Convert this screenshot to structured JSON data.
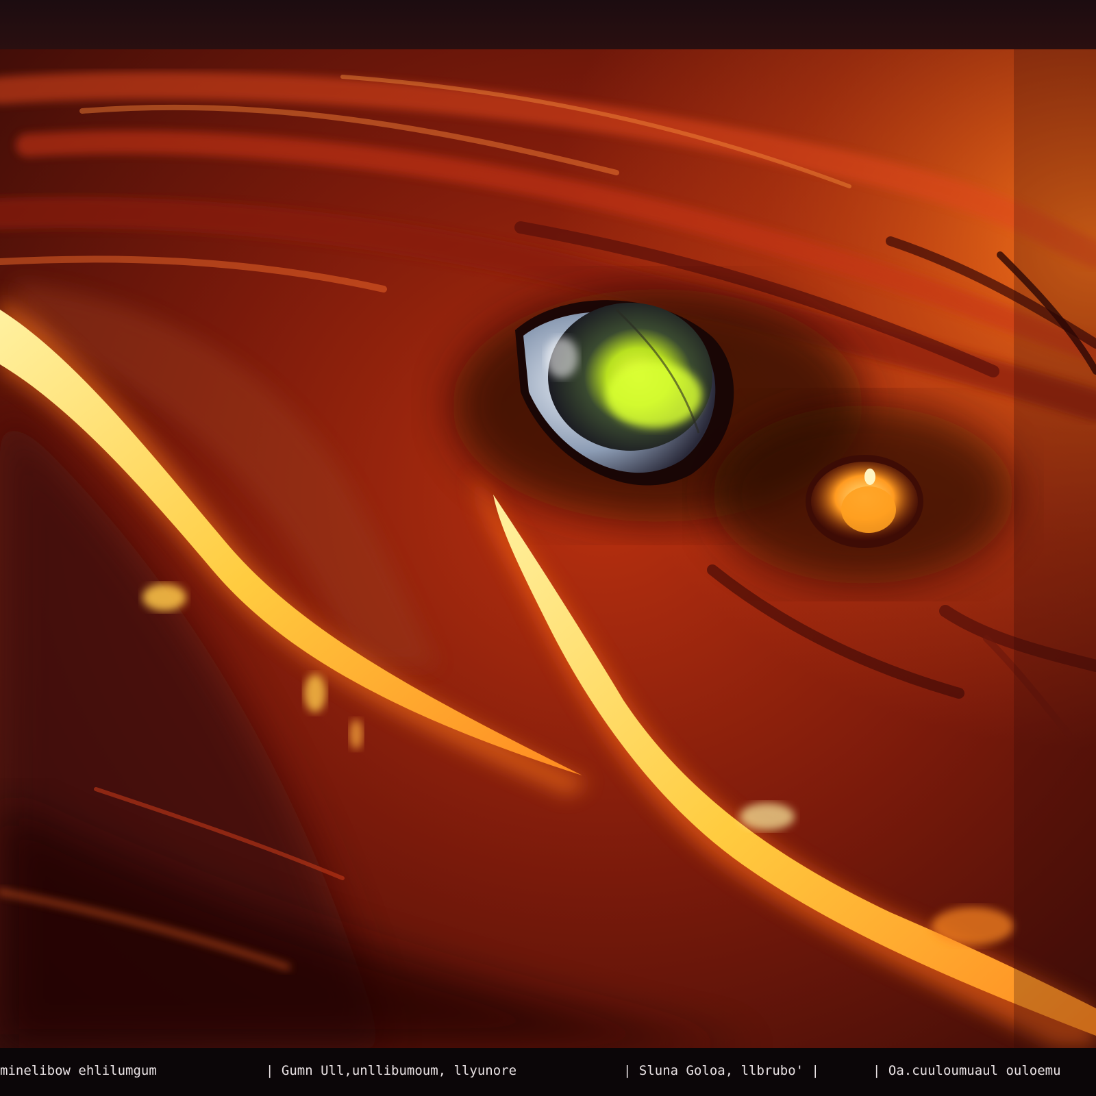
{
  "image": {
    "subject": "fiery creature eye",
    "palette": {
      "deep_red": "#5a120a",
      "ember": "#d8401a",
      "flame_orange": "#ff7a1a",
      "flame_yellow": "#ffd45a",
      "iris_green": "#c8f020",
      "iris_blue": "#c9d4e4",
      "shadow": "#1a0606"
    }
  },
  "caption_strip": {
    "segments": [
      "minelibow ehlilumgum",
      "| Gumn Ull,unllibumoum, llyunore",
      "| Sluna Goloa, llbrubo' |",
      "| Oa.cuuloumuaul ouloemu"
    ]
  }
}
